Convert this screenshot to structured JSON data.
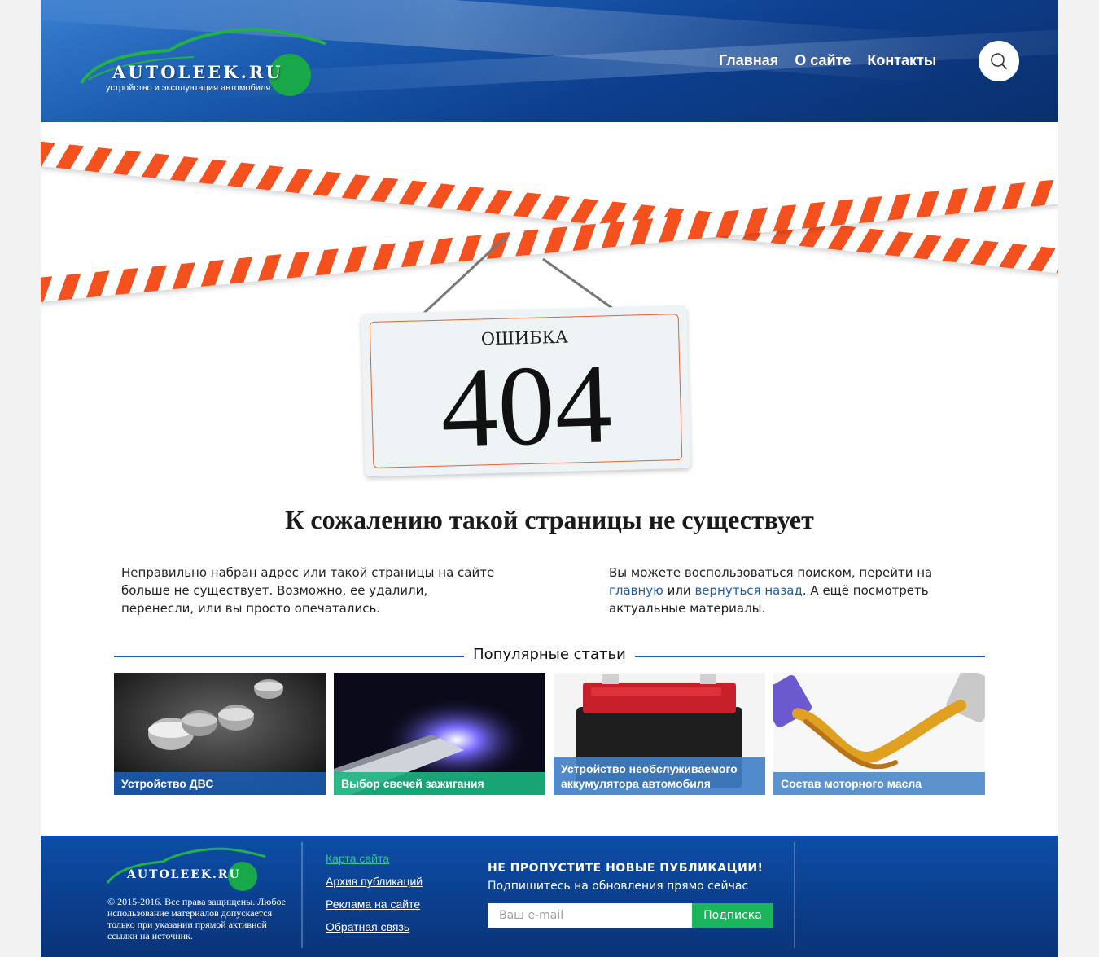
{
  "header": {
    "logo_text": "AUTOLEEK",
    "logo_ru": ".RU",
    "logo_subtitle": "устройство и эксплуатация автомобиля",
    "nav": [
      "Главная",
      "О сайте",
      "Контакты"
    ]
  },
  "error": {
    "sign_title": "ОШИБКА",
    "code": "404",
    "heading": "К сожалению такой страницы не существует",
    "left_text": "Неправильно набран адрес или такой страницы на сайте больше не существует. Возможно, ее удалили, перенесли, или вы просто опечатались.",
    "right_text_1": "Вы можете воспользоваться поиском, перейти на ",
    "right_link_home": "главную",
    "right_text_2": " или ",
    "right_link_back": "вернуться назад",
    "right_text_3": ". А ещё посмотреть актуальные материалы."
  },
  "popular": {
    "title": "Популярные статьи",
    "articles": [
      {
        "label": "Устройство ДВС",
        "color": "#1a5cb0"
      },
      {
        "label": "Выбор свечей зажигания",
        "color": "#1bb57f"
      },
      {
        "label": "Устройство необслуживаемого аккумулятора автомобиля",
        "color": "#3f7fc6"
      },
      {
        "label": "Состав моторного масла",
        "color": "#4a86c8"
      }
    ]
  },
  "footer": {
    "logo_text": "AUTOLEEK",
    "logo_ru": ".RU",
    "copyright": "© 2015-2016. Все права защищены. Любое использование материалов допускается только при указании прямой активной ссылки на источник.",
    "links": [
      "Карта сайта",
      "Архив публикаций",
      "Реклама на сайте",
      "Обратная связь"
    ],
    "subscribe_title": "НЕ ПРОПУСТИТЕ НОВЫЕ ПУБЛИКАЦИИ!",
    "subscribe_text": "Подпишитесь на обновления прямо сейчас",
    "email_placeholder": "Ваш e-mail",
    "subscribe_button": "Подписка"
  },
  "colors": {
    "accent_blue": "#1a5cb0",
    "tape_orange": "#f4511e",
    "brand_green": "#1bb55c"
  }
}
